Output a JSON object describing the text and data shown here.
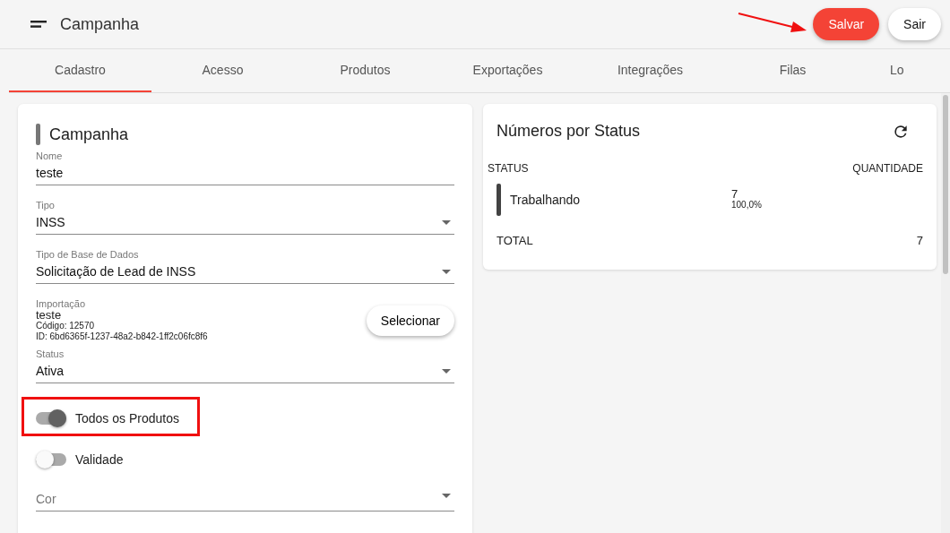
{
  "header": {
    "title": "Campanha",
    "buttons": [
      {
        "label": "Salvar",
        "kind": "primary"
      },
      {
        "label": "Sair",
        "kind": "plain"
      }
    ]
  },
  "tabs": [
    {
      "label": "Cadastro",
      "selected": true
    },
    {
      "label": "Acesso",
      "selected": false
    },
    {
      "label": "Produtos",
      "selected": false
    },
    {
      "label": "Exportações",
      "selected": false
    },
    {
      "label": "Integrações",
      "selected": false
    },
    {
      "label": "Filas",
      "selected": false
    },
    {
      "label": "Lo",
      "selected": false
    }
  ],
  "form": {
    "title": "Campanha",
    "items": [
      {
        "kind": "text",
        "label": "Nome",
        "value": "teste"
      },
      {
        "kind": "select",
        "label": "Tipo",
        "value": "INSS"
      },
      {
        "kind": "select",
        "label": "Tipo de Base de Dados",
        "value": "Solicitação de Lead de INSS"
      },
      {
        "kind": "import",
        "label": "Importação",
        "value": "teste",
        "code": "Código: 12570",
        "id": "ID: 6bd6365f-1237-48a2-b842-1ff2c06fc8f6",
        "button": "Selecionar"
      },
      {
        "kind": "select",
        "label": "Status",
        "value": "Ativa"
      },
      {
        "kind": "toggle",
        "label": "Todos os Produtos",
        "on": true
      },
      {
        "kind": "toggle",
        "label": "Validade",
        "on": false
      },
      {
        "kind": "select",
        "placeholder": "Cor"
      }
    ]
  },
  "stats": {
    "title": "Números por Status",
    "columns": [
      "STATUS",
      "QUANTIDADE"
    ],
    "rows": [
      {
        "status": "Trabalhando",
        "color": "#424242",
        "count": "7",
        "percent": "100,0%"
      }
    ],
    "total_label": "TOTAL",
    "total": "7"
  }
}
